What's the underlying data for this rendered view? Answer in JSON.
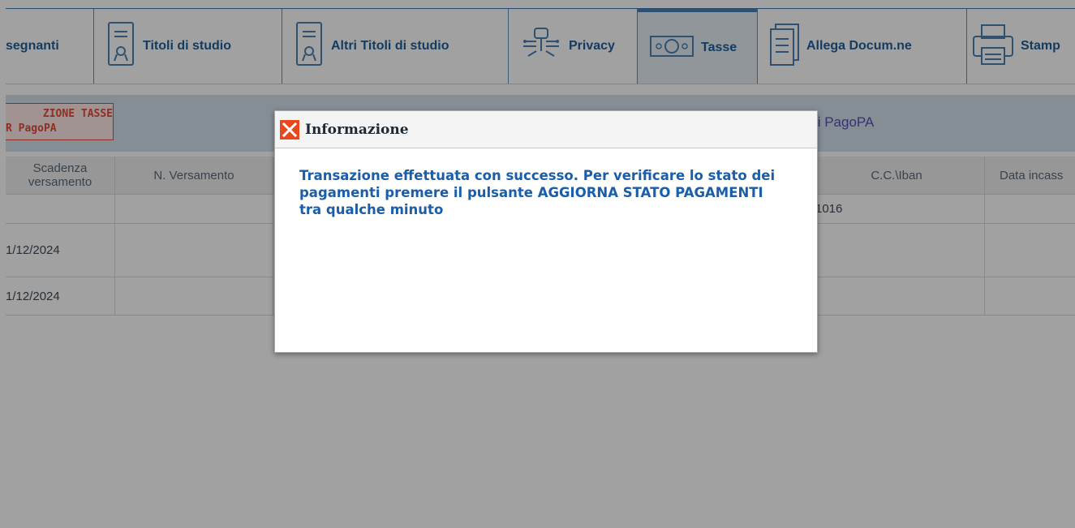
{
  "tabs": [
    {
      "label": "segnanti",
      "icon": ""
    },
    {
      "label": "Titoli di studio",
      "icon": "certificate-icon"
    },
    {
      "label": "Altri Titoli di studio",
      "icon": "certificate-icon"
    },
    {
      "label": "Privacy",
      "icon": "key-circuit-icon"
    },
    {
      "label": "Tasse",
      "icon": "banknote-icon",
      "active": true
    },
    {
      "label": "Allega Docum.ne",
      "icon": "document-icon"
    },
    {
      "label": "Stamp",
      "icon": "printer-icon"
    }
  ],
  "section": {
    "badge_line1": "ZIONE TASSE",
    "badge_line2": "R PagoPA",
    "pagopa_text": "ti PagoPA"
  },
  "table": {
    "headers": {
      "scadenza": "Scadenza versamento",
      "n_versamento": "N. Versamento",
      "cc_iban": "C.C.\\Iban",
      "data_incasso": "Data incass"
    },
    "rows": [
      {
        "scadenza": "",
        "iban": "1016"
      },
      {
        "scadenza": "1/12/2024",
        "iban": ""
      },
      {
        "scadenza": "1/12/2024",
        "iban": ""
      }
    ]
  },
  "dialog": {
    "title": "Informazione",
    "message": "Transazione effettuata con successo. Per verificare lo stato dei pagamenti premere il pulsante AGGIORNA STATO PAGAMENTI tra qualche minuto",
    "icon": "close-icon"
  },
  "colors": {
    "accent_blue": "#1f5f99",
    "error_red": "#e24a3b",
    "dialog_icon": "#e8481c",
    "message_blue": "#1a5da8"
  }
}
